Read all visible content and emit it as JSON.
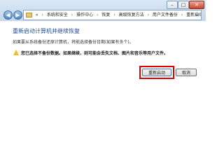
{
  "window_controls": {
    "minimize": "–",
    "maximize": "□",
    "close": "✕"
  },
  "nav": {
    "back": "◀",
    "forward": "▶"
  },
  "breadcrumb": [
    "«",
    "系统和安全",
    "操作中心",
    "恢复",
    "高级恢复方法",
    "用户文件备份",
    "重新启动"
  ],
  "main": {
    "title": "重新启动计算机并继续恢复",
    "description": "如果要从系统备份还原计算机，将能选择备份日期(如果有多个)。",
    "warning": "您已选择不备份数据。如果继续，则可能会丢失文档、图片和音乐等用户文件。"
  },
  "buttons": {
    "restart": "重新启动",
    "cancel": "取消"
  },
  "icons": {
    "warning": "warning-icon",
    "folder": "folder-icon",
    "refresh": "refresh-icon"
  },
  "colors": {
    "title": "#1f4e9c",
    "highlight": "#e00000"
  }
}
